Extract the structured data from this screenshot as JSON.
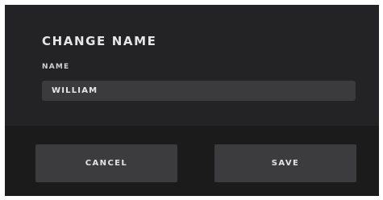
{
  "dialog": {
    "title": "CHANGE NAME",
    "field_label": "NAME",
    "name_value": "WILLIAM",
    "cancel_label": "CANCEL",
    "save_label": "SAVE"
  },
  "colors": {
    "dialog_bg": "#232325",
    "footer_bg": "#1b1b1c",
    "input_bg": "#3b3b3d",
    "button_bg": "#3c3c3e",
    "text": "#e6e6e6"
  }
}
